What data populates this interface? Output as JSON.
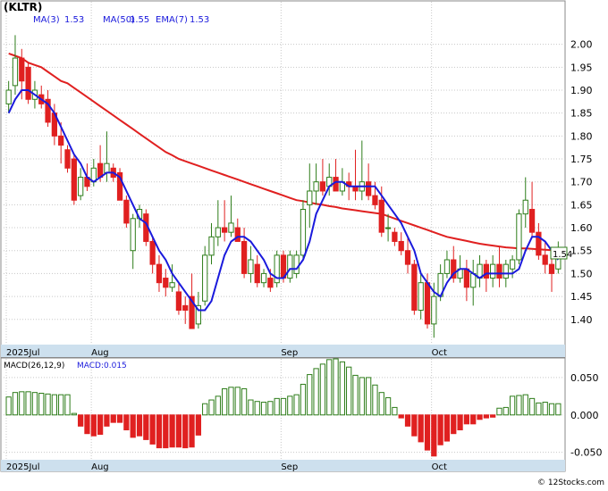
{
  "title": "(KLTR)",
  "legend": {
    "ma3_label": "MA(3)",
    "ma3_value": "1.53",
    "ma50_label": "MA(50)",
    "ma50_value": "1.55",
    "ema7_label": "EMA(7)",
    "ema7_value": "1.53"
  },
  "last_price": "1.54",
  "macd_legend": {
    "params": "MACD(26,12,9)",
    "value_label": "MACD:0.015"
  },
  "watermark": "© 12Stocks.com",
  "colors": {
    "up": "#2e7d1a",
    "down": "#e02020",
    "ma3": "#1a1adc",
    "ma50": "#e02020",
    "axis_band": "#cde0ee",
    "grid": "#c8c8c8"
  },
  "chart_data": [
    {
      "type": "candlestick",
      "x_labels": [
        "2025Jul",
        "Aug",
        "Sep",
        "Oct"
      ],
      "y_ticks": [
        "2.00",
        "1.95",
        "1.90",
        "1.85",
        "1.80",
        "1.75",
        "1.70",
        "1.65",
        "1.60",
        "1.55",
        "1.50",
        "1.45",
        "1.40"
      ],
      "ylim": [
        1.345,
        2.085
      ],
      "ohlc": [
        [
          1.87,
          1.92,
          1.85,
          1.9
        ],
        [
          1.91,
          2.02,
          1.89,
          1.97
        ],
        [
          1.97,
          1.99,
          1.88,
          1.92
        ],
        [
          1.95,
          1.96,
          1.87,
          1.88
        ],
        [
          1.88,
          1.92,
          1.86,
          1.9
        ],
        [
          1.89,
          1.91,
          1.86,
          1.87
        ],
        [
          1.88,
          1.9,
          1.82,
          1.83
        ],
        [
          1.85,
          1.87,
          1.78,
          1.8
        ],
        [
          1.8,
          1.83,
          1.74,
          1.78
        ],
        [
          1.77,
          1.78,
          1.72,
          1.73
        ],
        [
          1.75,
          1.76,
          1.65,
          1.66
        ],
        [
          1.67,
          1.73,
          1.66,
          1.71
        ],
        [
          1.71,
          1.74,
          1.68,
          1.69
        ],
        [
          1.7,
          1.75,
          1.69,
          1.73
        ],
        [
          1.74,
          1.78,
          1.7,
          1.71
        ],
        [
          1.72,
          1.81,
          1.7,
          1.74
        ],
        [
          1.73,
          1.74,
          1.7,
          1.71
        ],
        [
          1.72,
          1.73,
          1.66,
          1.66
        ],
        [
          1.66,
          1.67,
          1.6,
          1.61
        ],
        [
          1.55,
          1.63,
          1.51,
          1.62
        ],
        [
          1.62,
          1.65,
          1.6,
          1.64
        ],
        [
          1.63,
          1.64,
          1.56,
          1.57
        ],
        [
          1.57,
          1.58,
          1.5,
          1.52
        ],
        [
          1.52,
          1.54,
          1.46,
          1.48
        ],
        [
          1.49,
          1.51,
          1.45,
          1.47
        ],
        [
          1.47,
          1.52,
          1.46,
          1.48
        ],
        [
          1.46,
          1.48,
          1.41,
          1.42
        ],
        [
          1.43,
          1.45,
          1.39,
          1.42
        ],
        [
          1.45,
          1.5,
          1.38,
          1.38
        ],
        [
          1.39,
          1.46,
          1.38,
          1.43
        ],
        [
          1.44,
          1.56,
          1.43,
          1.54
        ],
        [
          1.54,
          1.61,
          1.52,
          1.58
        ],
        [
          1.58,
          1.66,
          1.56,
          1.6
        ],
        [
          1.6,
          1.66,
          1.57,
          1.59
        ],
        [
          1.59,
          1.67,
          1.58,
          1.61
        ],
        [
          1.6,
          1.62,
          1.57,
          1.57
        ],
        [
          1.57,
          1.6,
          1.49,
          1.5
        ],
        [
          1.5,
          1.56,
          1.48,
          1.53
        ],
        [
          1.52,
          1.54,
          1.47,
          1.48
        ],
        [
          1.48,
          1.51,
          1.47,
          1.5
        ],
        [
          1.49,
          1.51,
          1.46,
          1.47
        ],
        [
          1.48,
          1.55,
          1.47,
          1.54
        ],
        [
          1.54,
          1.55,
          1.48,
          1.49
        ],
        [
          1.49,
          1.55,
          1.48,
          1.54
        ],
        [
          1.5,
          1.55,
          1.49,
          1.54
        ],
        [
          1.54,
          1.66,
          1.53,
          1.64
        ],
        [
          1.65,
          1.74,
          1.6,
          1.68
        ],
        [
          1.68,
          1.74,
          1.65,
          1.7
        ],
        [
          1.7,
          1.75,
          1.67,
          1.68
        ],
        [
          1.69,
          1.74,
          1.67,
          1.71
        ],
        [
          1.71,
          1.75,
          1.68,
          1.68
        ],
        [
          1.68,
          1.73,
          1.67,
          1.7
        ],
        [
          1.7,
          1.72,
          1.66,
          1.69
        ],
        [
          1.69,
          1.77,
          1.66,
          1.68
        ],
        [
          1.68,
          1.79,
          1.66,
          1.7
        ],
        [
          1.7,
          1.74,
          1.66,
          1.67
        ],
        [
          1.67,
          1.7,
          1.64,
          1.65
        ],
        [
          1.66,
          1.69,
          1.58,
          1.59
        ],
        [
          1.6,
          1.63,
          1.57,
          1.6
        ],
        [
          1.59,
          1.6,
          1.56,
          1.57
        ],
        [
          1.57,
          1.59,
          1.54,
          1.55
        ],
        [
          1.55,
          1.58,
          1.5,
          1.52
        ],
        [
          1.52,
          1.53,
          1.41,
          1.42
        ],
        [
          1.42,
          1.5,
          1.4,
          1.48
        ],
        [
          1.48,
          1.5,
          1.38,
          1.39
        ],
        [
          1.39,
          1.48,
          1.36,
          1.45
        ],
        [
          1.45,
          1.52,
          1.44,
          1.5
        ],
        [
          1.5,
          1.55,
          1.49,
          1.53
        ],
        [
          1.53,
          1.56,
          1.48,
          1.49
        ],
        [
          1.49,
          1.54,
          1.48,
          1.51
        ],
        [
          1.51,
          1.53,
          1.44,
          1.47
        ],
        [
          1.47,
          1.53,
          1.43,
          1.5
        ],
        [
          1.49,
          1.54,
          1.47,
          1.52
        ],
        [
          1.52,
          1.53,
          1.46,
          1.49
        ],
        [
          1.49,
          1.54,
          1.47,
          1.52
        ],
        [
          1.52,
          1.56,
          1.47,
          1.49
        ],
        [
          1.49,
          1.53,
          1.47,
          1.52
        ],
        [
          1.51,
          1.54,
          1.49,
          1.53
        ],
        [
          1.53,
          1.64,
          1.52,
          1.63
        ],
        [
          1.63,
          1.71,
          1.6,
          1.66
        ],
        [
          1.64,
          1.7,
          1.58,
          1.59
        ],
        [
          1.59,
          1.61,
          1.53,
          1.54
        ],
        [
          1.54,
          1.57,
          1.5,
          1.52
        ],
        [
          1.52,
          1.55,
          1.46,
          1.5
        ],
        [
          1.51,
          1.57,
          1.5,
          1.54
        ]
      ],
      "ma3": [
        1.85,
        1.88,
        1.9,
        1.9,
        1.89,
        1.88,
        1.87,
        1.85,
        1.82,
        1.79,
        1.76,
        1.74,
        1.71,
        1.7,
        1.71,
        1.72,
        1.72,
        1.71,
        1.68,
        1.65,
        1.62,
        1.61,
        1.58,
        1.55,
        1.53,
        1.5,
        1.48,
        1.46,
        1.44,
        1.42,
        1.42,
        1.44,
        1.49,
        1.54,
        1.57,
        1.58,
        1.58,
        1.57,
        1.55,
        1.53,
        1.5,
        1.49,
        1.49,
        1.51,
        1.51,
        1.53,
        1.57,
        1.63,
        1.66,
        1.69,
        1.7,
        1.7,
        1.69,
        1.69,
        1.69,
        1.69,
        1.69,
        1.67,
        1.65,
        1.63,
        1.61,
        1.58,
        1.55,
        1.5,
        1.48,
        1.46,
        1.45,
        1.48,
        1.5,
        1.51,
        1.51,
        1.5,
        1.49,
        1.5,
        1.5,
        1.5,
        1.5,
        1.5,
        1.51,
        1.55,
        1.58,
        1.58,
        1.57,
        1.55,
        1.53
      ],
      "ma50": [
        1.98,
        1.975,
        1.97,
        1.96,
        1.955,
        1.95,
        1.94,
        1.93,
        1.92,
        1.915,
        1.905,
        1.895,
        1.885,
        1.875,
        1.865,
        1.855,
        1.845,
        1.835,
        1.825,
        1.815,
        1.805,
        1.795,
        1.785,
        1.775,
        1.765,
        1.758,
        1.75,
        1.745,
        1.74,
        1.735,
        1.73,
        1.725,
        1.72,
        1.715,
        1.71,
        1.705,
        1.7,
        1.695,
        1.69,
        1.685,
        1.68,
        1.675,
        1.67,
        1.665,
        1.66,
        1.658,
        1.655,
        1.652,
        1.65,
        1.647,
        1.645,
        1.642,
        1.64,
        1.638,
        1.636,
        1.634,
        1.632,
        1.63,
        1.625,
        1.62,
        1.615,
        1.61,
        1.605,
        1.6,
        1.595,
        1.59,
        1.585,
        1.58,
        1.577,
        1.574,
        1.571,
        1.568,
        1.565,
        1.563,
        1.561,
        1.559,
        1.557,
        1.556,
        1.555,
        1.555,
        1.554,
        1.553,
        1.552,
        1.551,
        1.55
      ]
    },
    {
      "type": "bar",
      "name": "MACD",
      "y_ticks": [
        "0.050",
        "0.000",
        "-0.050"
      ],
      "ylim": [
        -0.06,
        0.075
      ],
      "values": [
        0.024,
        0.03,
        0.031,
        0.031,
        0.03,
        0.029,
        0.028,
        0.027,
        0.027,
        0.027,
        0.002,
        -0.015,
        -0.025,
        -0.028,
        -0.026,
        -0.015,
        -0.01,
        -0.01,
        -0.02,
        -0.03,
        -0.028,
        -0.033,
        -0.039,
        -0.044,
        -0.044,
        -0.043,
        -0.043,
        -0.044,
        -0.043,
        -0.027,
        0.015,
        0.02,
        0.025,
        0.035,
        0.037,
        0.037,
        0.035,
        0.02,
        0.018,
        0.017,
        0.018,
        0.022,
        0.022,
        0.025,
        0.027,
        0.041,
        0.054,
        0.062,
        0.068,
        0.074,
        0.075,
        0.071,
        0.064,
        0.053,
        0.05,
        0.05,
        0.04,
        0.03,
        0.023,
        0.01,
        -0.004,
        -0.015,
        -0.028,
        -0.036,
        -0.047,
        -0.055,
        -0.04,
        -0.035,
        -0.025,
        -0.02,
        -0.012,
        -0.012,
        -0.006,
        -0.004,
        -0.003,
        0.009,
        0.01,
        0.025,
        0.026,
        0.027,
        0.022,
        0.016,
        0.017,
        0.015,
        0.015
      ]
    }
  ]
}
